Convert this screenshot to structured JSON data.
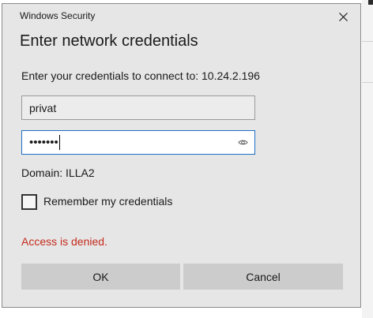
{
  "window": {
    "title": "Windows Security",
    "close_icon": "close-icon"
  },
  "heading": "Enter network credentials",
  "prompt": "Enter your credentials to connect to: 10.24.2.196",
  "username": {
    "value": "privat"
  },
  "password": {
    "masked_value": "•••••••",
    "reveal_icon": "eye-icon"
  },
  "domain_text": "Domain: ILLA2",
  "remember": {
    "label": "Remember my credentials",
    "checked": false
  },
  "error_text": "Access is denied.",
  "buttons": {
    "ok": "OK",
    "cancel": "Cancel"
  },
  "colors": {
    "accent": "#1f6fc6",
    "error": "#c42b1c",
    "dialog_bg": "#e6e6e6",
    "button_bg": "#cccccc"
  }
}
